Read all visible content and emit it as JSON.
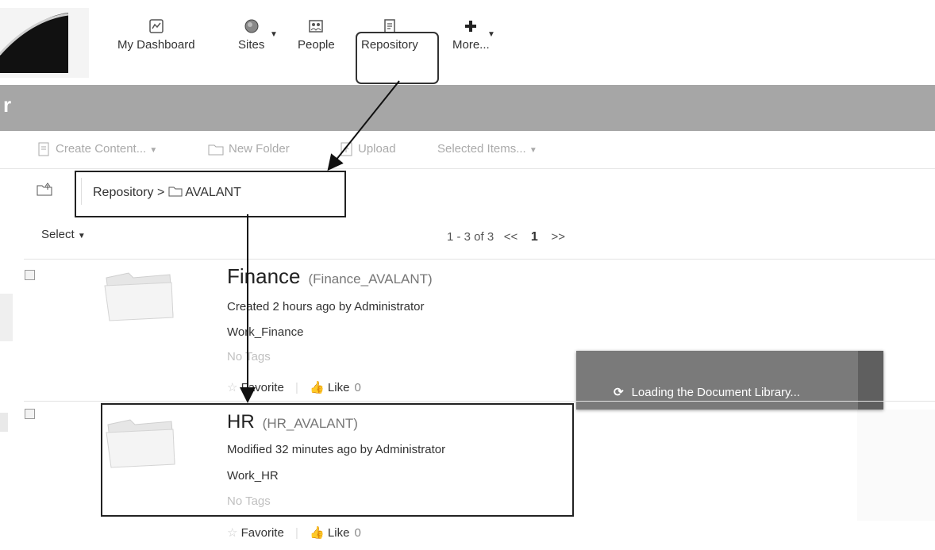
{
  "header": {
    "nav": [
      {
        "label": "My Dashboard",
        "icon": "dashboard-icon"
      },
      {
        "label": "Sites",
        "icon": "sites-icon"
      },
      {
        "label": "People",
        "icon": "people-icon"
      },
      {
        "label": "Repository",
        "icon": "repository-icon"
      },
      {
        "label": "More...",
        "icon": "plus-icon"
      }
    ]
  },
  "band": {
    "title": "r"
  },
  "toolbar": {
    "create_content": "Create Content...",
    "new_folder": "New Folder",
    "upload": "Upload",
    "selected_items": "Selected Items..."
  },
  "breadcrumb": {
    "root": "Repository",
    "separator": ">",
    "current": "AVALANT"
  },
  "list": {
    "select_label": "Select",
    "pager": {
      "range": "1 - 3 of 3",
      "prev": "<<",
      "page": "1",
      "next": ">>"
    },
    "items": [
      {
        "name": "Finance",
        "title": "(Finance_AVALANT)",
        "meta": "Created 2 hours ago by Administrator",
        "description": "Work_Finance",
        "tags": "No Tags",
        "favorite": "Favorite",
        "like": "Like",
        "like_count": "0"
      },
      {
        "name": "HR",
        "title": "(HR_AVALANT)",
        "meta": "Modified 32 minutes ago by Administrator",
        "description": "Work_HR",
        "tags": "No Tags",
        "favorite": "Favorite",
        "like": "Like",
        "like_count": "0"
      }
    ]
  },
  "loading": {
    "text": "Loading the Document Library..."
  }
}
